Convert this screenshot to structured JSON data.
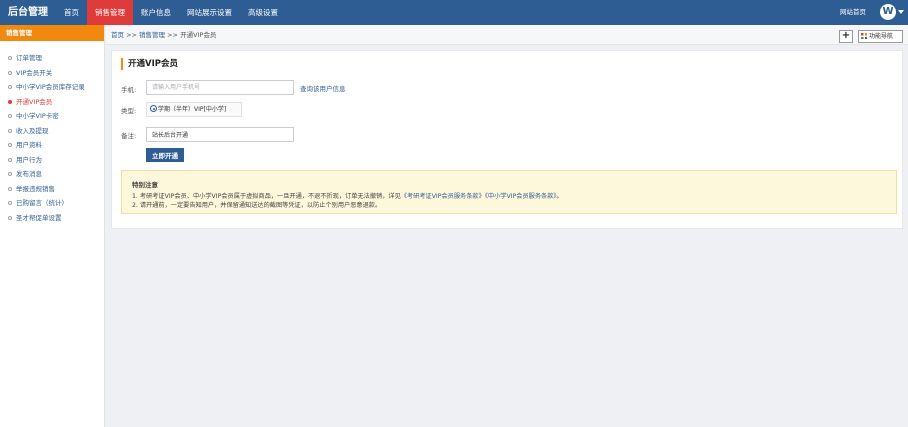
{
  "header": {
    "logo": "后台管理",
    "nav": [
      "首页",
      "销售管理",
      "账户信息",
      "网站展示设置",
      "高级设置"
    ],
    "active_nav": 1,
    "site_home": "网站首页",
    "avatar_letter": "W"
  },
  "sidebar": {
    "title": "销售管理",
    "items": [
      {
        "label": "订单管理"
      },
      {
        "label": "VIP会员开关"
      },
      {
        "label": "中小学VIP会员库存记录"
      },
      {
        "label": "开通VIP会员",
        "active": true
      },
      {
        "label": "中小学VIP卡密"
      },
      {
        "label": "收入及提现"
      },
      {
        "label": "用户资料"
      },
      {
        "label": "用户行为"
      },
      {
        "label": "发布消息"
      },
      {
        "label": "举报违规销售"
      },
      {
        "label": "已购留言（统计）"
      },
      {
        "label": "圣才帮促单设置"
      }
    ]
  },
  "breadcrumb": {
    "home": "首页",
    "sep1": " >> ",
    "section": "销售管理",
    "sep2": " >> ",
    "current": "开通VIP会员"
  },
  "toolbar": {
    "plus": "+",
    "func_nav": "功能导航"
  },
  "form": {
    "title": "开通VIP会员",
    "phone_label": "手机:",
    "phone_placeholder": "请输入用户手机号",
    "query_link": "查询该用户信息",
    "type_label": "类型:",
    "type_option": "学期（半年）VIP[中小学]",
    "remark_label": "备注:",
    "remark_value": "站长后台开通",
    "submit": "立即开通"
  },
  "notice": {
    "title": "特别注意",
    "line1_prefix": "1. 考研考证VIP会员、中小学VIP会员属于虚拟商品，一旦开通，不退不折现，订单无法撤销，详见",
    "link1": "《考研考证VIP会员服务条款》",
    "link2": "《中小学VIP会员服务条款》",
    "line1_suffix": "。",
    "line2": "2. 请开通前，一定要告知用户，并保留通知送达的截图等凭证，以防止个别用户恶意退款。"
  },
  "colors": {
    "header_bg": "#2e5d94",
    "active_nav": "#e03b3b",
    "accent_orange": "#f0890e",
    "notice_bg": "#fdf7dc"
  }
}
